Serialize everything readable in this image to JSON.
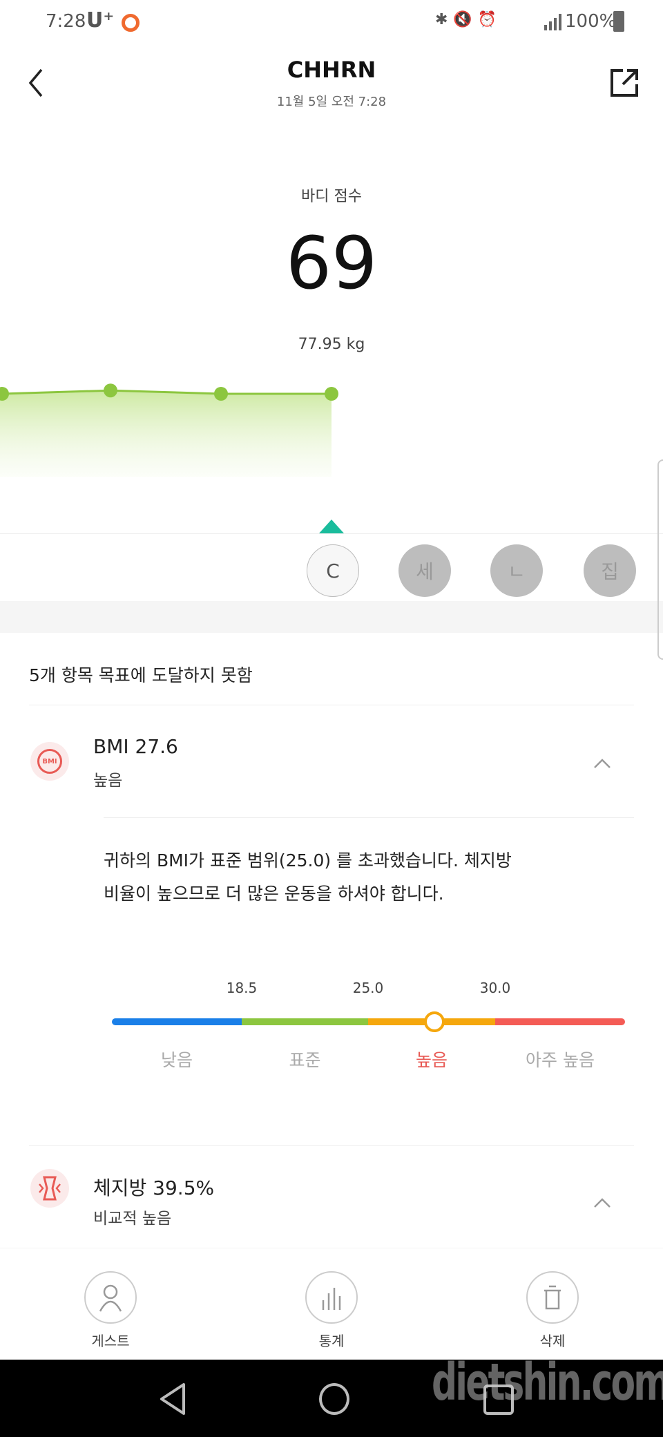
{
  "status_bar": {
    "time": "7:28",
    "carrier": "U⁺",
    "battery": "100%"
  },
  "header": {
    "title": "CHHRN",
    "date": "11월 5일 오전 7:28"
  },
  "score": {
    "label": "바디 점수",
    "value": "69",
    "weight": "77.95 kg"
  },
  "trend": {
    "values": [
      69,
      69.3,
      69,
      69
    ]
  },
  "user_tabs": [
    {
      "label": "C",
      "selected": true
    },
    {
      "label": "세"
    },
    {
      "label": "ㄴ"
    },
    {
      "label": "집"
    }
  ],
  "summary": "5개 항목 목표에 도달하지 못함",
  "bmi": {
    "title": "BMI  27.6",
    "value": 27.6,
    "status": "높음",
    "description_1": "귀하의 BMI가 표준 범위(25.0) 를 초과했습니다. 체지방",
    "description_2": "비율이 높으므로 더 많은 운동을 하셔야 합니다.",
    "ticks": [
      "18.5",
      "25.0",
      "30.0"
    ],
    "ranges": [
      {
        "label": "낮음",
        "color": "#1a7fe8"
      },
      {
        "label": "표준",
        "color": "#8cc63f"
      },
      {
        "label": "높음",
        "color": "#f5a70d"
      },
      {
        "label": "아주 높음",
        "color": "#f45b55"
      }
    ],
    "active_color": "#e85a55"
  },
  "body_fat": {
    "title": "체지방  39.5%",
    "status": "비교적 높음"
  },
  "actions": [
    {
      "label": "게스트",
      "icon": "person-icon"
    },
    {
      "label": "통계",
      "icon": "bar-chart-icon"
    },
    {
      "label": "삭제",
      "icon": "trash-icon"
    }
  ],
  "watermark": "dietshin.com"
}
